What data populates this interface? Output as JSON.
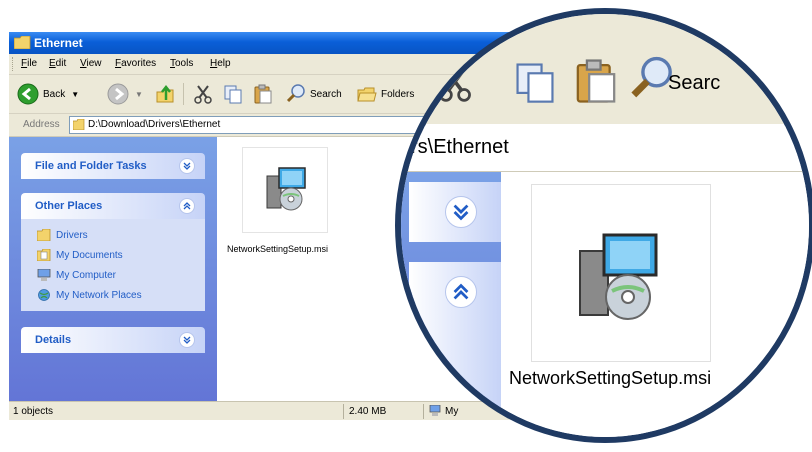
{
  "window": {
    "title": "Ethernet"
  },
  "menu": [
    "File",
    "Edit",
    "View",
    "Favorites",
    "Tools",
    "Help"
  ],
  "toolbar": {
    "back": "Back",
    "search": "Search",
    "folders": "Folders"
  },
  "address": {
    "label": "Address",
    "value": "D:\\Download\\Drivers\\Ethernet"
  },
  "tasks": {
    "file_folder_tasks": "File and Folder Tasks",
    "other_places": "Other Places",
    "places": [
      "Drivers",
      "My Documents",
      "My Computer",
      "My Network Places"
    ],
    "details": "Details"
  },
  "file": {
    "name": "NetworkSettingSetup.msi"
  },
  "status": {
    "objects": "1 objects",
    "size": "2.40 MB",
    "location": "My"
  },
  "magnifier": {
    "address_fragment": "rs\\Ethernet",
    "search_fragment": "Searc",
    "file_name": "NetworkSettingSetup.msi"
  },
  "colors": {
    "xp_blue": "#0a5fd8",
    "task_blue": "#215dc6",
    "pane": "#6f8ae0",
    "ring": "#1f3a63"
  }
}
